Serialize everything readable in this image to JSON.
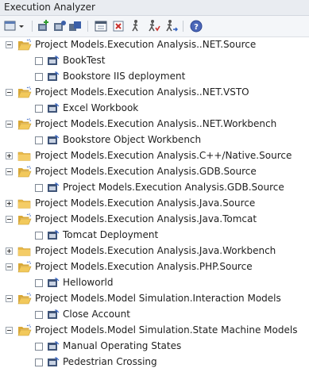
{
  "window": {
    "title": "Execution Analyzer"
  },
  "toolbar": {
    "buttons": [
      {
        "icon": "new-script-dropdown-icon"
      },
      {
        "icon": "add-package-icon"
      },
      {
        "icon": "add-script-icon"
      },
      {
        "icon": "copy-script-icon"
      },
      {
        "icon": "properties-icon"
      },
      {
        "icon": "delete-icon"
      },
      {
        "icon": "run-icon"
      },
      {
        "icon": "debug-run-icon"
      },
      {
        "icon": "step-run-icon"
      },
      {
        "icon": "help-icon"
      }
    ]
  },
  "tree": {
    "groups": [
      {
        "label": "Project Models.Execution Analysis..NET.Source",
        "expanded": true,
        "items": [
          "BookTest",
          "Bookstore IIS deployment"
        ]
      },
      {
        "label": "Project Models.Execution Analysis..NET.VSTO",
        "expanded": true,
        "items": [
          "Excel Workbook"
        ]
      },
      {
        "label": "Project Models.Execution Analysis..NET.Workbench",
        "expanded": true,
        "items": [
          "Bookstore Object Workbench"
        ]
      },
      {
        "label": "Project Models.Execution Analysis.C++/Native.Source",
        "expanded": false,
        "items": []
      },
      {
        "label": "Project Models.Execution Analysis.GDB.Source",
        "expanded": true,
        "items": [
          "Project Models.Execution Analysis.GDB.Source"
        ]
      },
      {
        "label": "Project Models.Execution Analysis.Java.Source",
        "expanded": false,
        "items": []
      },
      {
        "label": "Project Models.Execution Analysis.Java.Tomcat",
        "expanded": true,
        "items": [
          "Tomcat Deployment"
        ]
      },
      {
        "label": "Project Models.Execution Analysis.Java.Workbench",
        "expanded": false,
        "items": []
      },
      {
        "label": "Project Models.Execution Analysis.PHP.Source",
        "expanded": true,
        "items": [
          "Helloworld"
        ]
      },
      {
        "label": "Project Models.Model Simulation.Interaction Models",
        "expanded": true,
        "items": [
          "Close Account"
        ]
      },
      {
        "label": "Project Models.Model Simulation.State Machine Models",
        "expanded": true,
        "items": [
          "Manual Operating States",
          "Pedestrian Crossing"
        ]
      }
    ]
  },
  "colors": {
    "folder": "#e9b949",
    "accent": "#2f5fbf"
  }
}
